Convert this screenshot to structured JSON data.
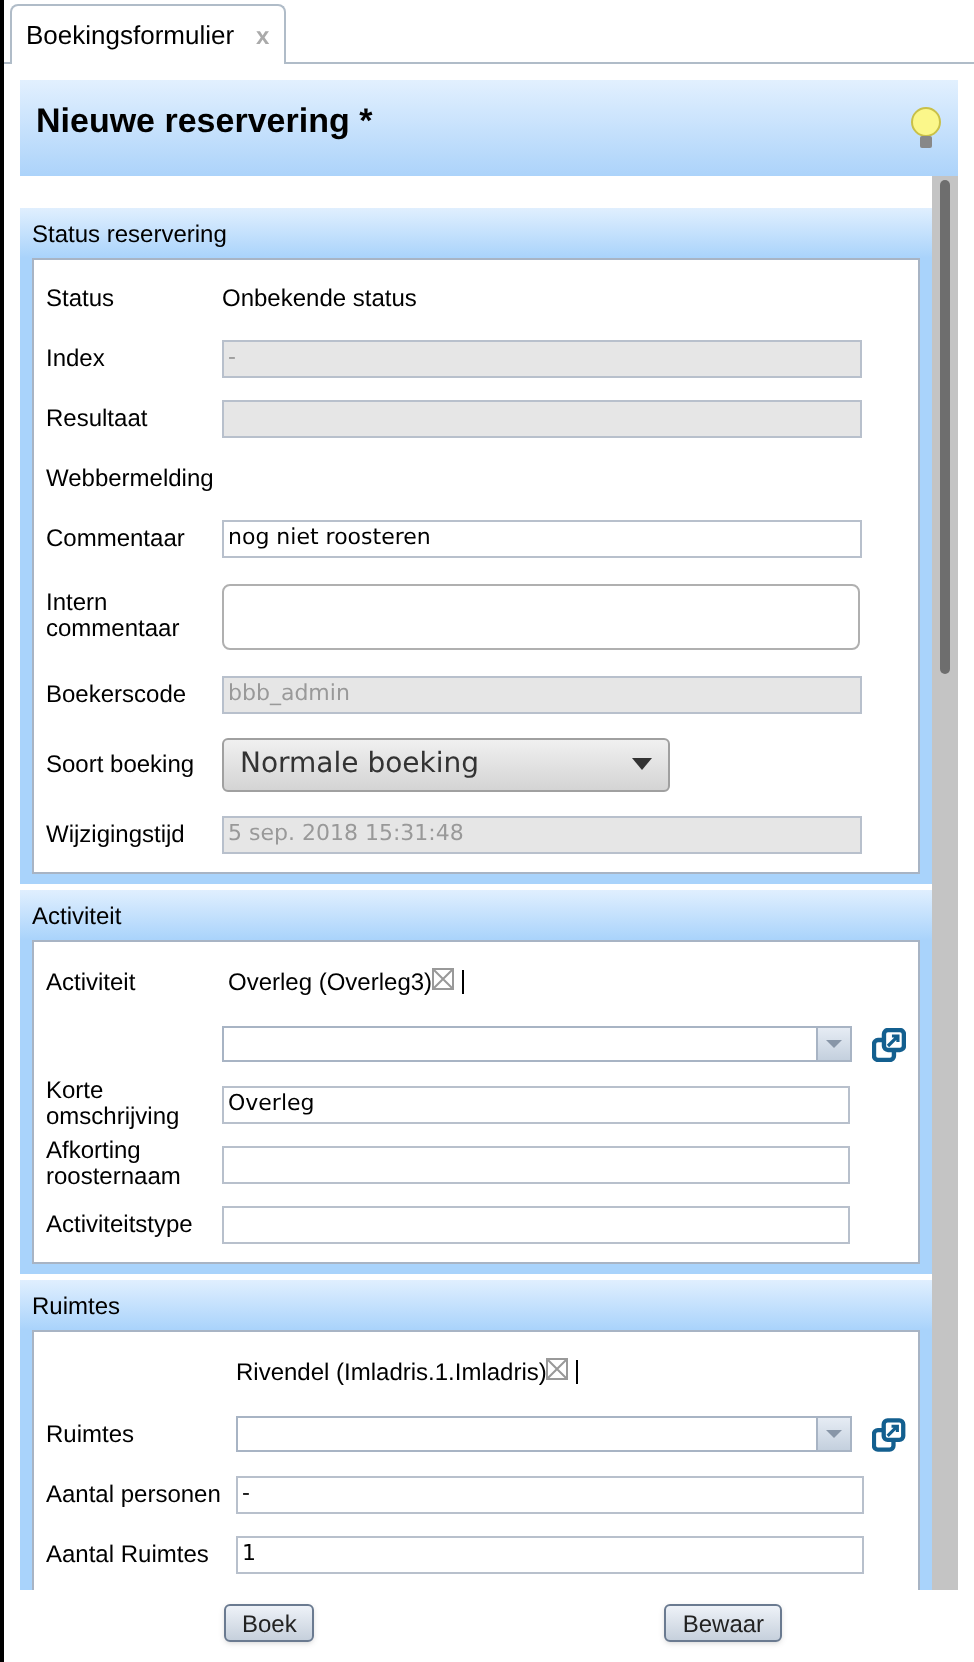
{
  "tabs": [
    {
      "label": "Boekingsformulier",
      "close": "x",
      "selected": true
    }
  ],
  "title": "Nieuwe reservering *",
  "sections": [
    {
      "title": "Status reservering",
      "rows": [
        {
          "kind": "text",
          "label": "Status",
          "value": "Onbekende status"
        },
        {
          "kind": "field",
          "label": "Index",
          "value": "-",
          "disabled": true
        },
        {
          "kind": "field",
          "label": "Resultaat",
          "disabled": true
        },
        {
          "kind": "label",
          "label": "Webbermelding"
        },
        {
          "kind": "field",
          "label": "Commentaar",
          "value": "nog niet roosteren",
          "disabled": false
        },
        {
          "kind": "textarea",
          "label": "Intern commentaar"
        },
        {
          "kind": "field",
          "label": "Boekerscode",
          "value": "bbb_admin",
          "disabled": true
        },
        {
          "kind": "dropdown",
          "label": "Soort boeking",
          "value": "Normale boeking"
        },
        {
          "kind": "field",
          "label": "Wijzigingstijd",
          "value": "5 sep. 2018 15:31:48",
          "disabled": true
        }
      ]
    },
    {
      "title": "Activiteit",
      "rows": [
        {
          "kind": "chip",
          "label": "Activiteit",
          "value": "Overleg (Overleg3)"
        },
        {
          "kind": "combo"
        },
        {
          "kind": "field",
          "label": "Korte omschrijving",
          "value": "Overleg",
          "disabled": false
        },
        {
          "kind": "field",
          "label": "Afkorting roosternaam",
          "disabled": false
        },
        {
          "kind": "field",
          "label": "Activiteitstype",
          "disabled": false
        }
      ]
    },
    {
      "title": "Ruimtes",
      "rows": [
        {
          "kind": "chip",
          "value": "Rivendel (Imladris.1.Imladris)"
        },
        {
          "kind": "combo",
          "label": "Ruimtes"
        },
        {
          "kind": "field",
          "label": "Aantal personen",
          "value": "-",
          "disabled": false
        },
        {
          "kind": "field",
          "label": "Aantal Ruimtes",
          "value": "1",
          "disabled": false
        }
      ]
    }
  ],
  "buttons": [
    "Boek",
    "Bewaar"
  ]
}
